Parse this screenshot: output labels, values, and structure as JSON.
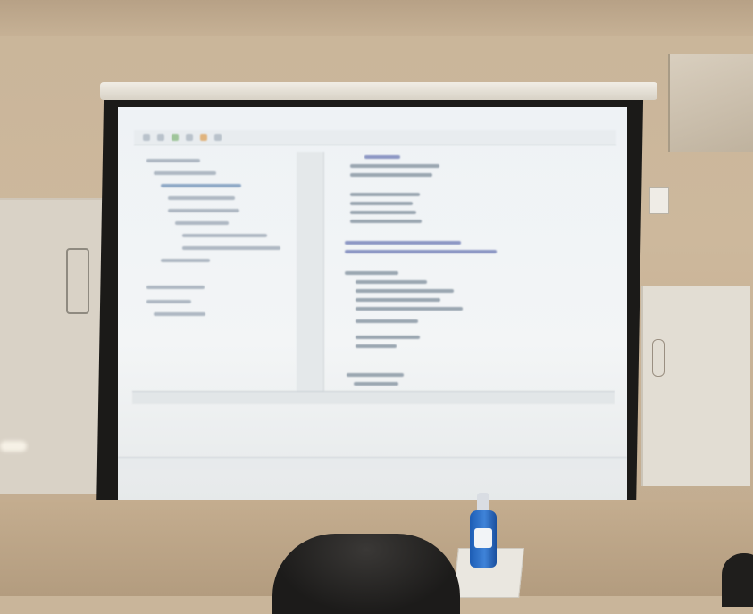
{
  "scene": {
    "kind": "photo of a projected IDE on a screen in a classroom",
    "colors": {
      "wall": "#cdb89c",
      "screen": "#eef2f5",
      "screen_frame": "#1b1a18",
      "bottle": "#2f6fcc"
    }
  },
  "projected_ide": {
    "toolbar_icons": [
      "toolbar-icon",
      "toolbar-icon",
      "toolbar-icon",
      "toolbar-icon",
      "toolbar-icon",
      "toolbar-icon"
    ],
    "panels": [
      "project-tree",
      "line-gutter",
      "code-editor",
      "console",
      "status-bar"
    ]
  },
  "objects": [
    "projection-screen",
    "whiteboard",
    "chair",
    "tissue-box",
    "hand-sanitizer-bottle",
    "wall-switch",
    "cabinet"
  ]
}
